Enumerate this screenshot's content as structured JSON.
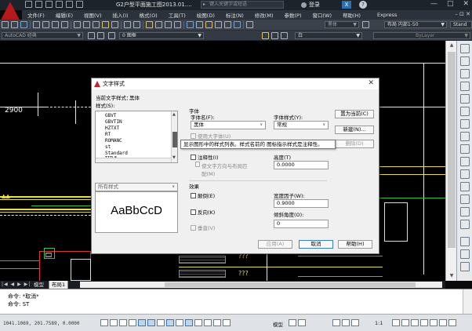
{
  "titlebar": {
    "doc_title": "G2户型平面施工图2013.01....",
    "search_placeholder": "键入关键字或短语",
    "login_label": "登录",
    "help_label": "?",
    "x_label": "X",
    "min": "—",
    "max": "□",
    "close": "✕"
  },
  "menubar": {
    "items": [
      "文件(F)",
      "编辑(E)",
      "视图(V)",
      "插入(I)",
      "格式(O)",
      "工具(T)",
      "绘图(D)",
      "标注(N)",
      "修改(M)",
      "参数(P)",
      "窗口(W)",
      "帮助(H)",
      "Express"
    ],
    "ctrls": "– ⊡ ✕"
  },
  "toolbar1": {
    "font_combo": "黑体",
    "layout_combo": "布局 内部1-50",
    "standard_label": "Stand"
  },
  "toolbar2": {
    "workspace_combo": "AutoCAD 经典",
    "layer_combo": "0 图框",
    "color_combo": "白",
    "linetype_combo": "ByLayer"
  },
  "drawing": {
    "dim_text": "2900",
    "q1": "???",
    "q2": "???"
  },
  "tabs": {
    "nav": "|◀ ◀ ▶ ▶|",
    "model": "模型",
    "layout": "布局1"
  },
  "cmdline": {
    "line1": "命令: *取消*",
    "line2": "命令: ST"
  },
  "statusbar": {
    "coords": "1041.1069, 201.7589, 0.0000",
    "model_label": "模型",
    "scale_label": "1:1"
  },
  "dialog": {
    "title": "文字样式",
    "current_style_label": "当前文字样式：",
    "current_style_value": "黑体",
    "styles_label": "样式(S):",
    "styles": [
      "GBVT",
      "GBVTIN",
      "HZTXT",
      "RT",
      "ROMANC",
      "st",
      "Standard",
      "TITLE…"
    ],
    "filter_value": "所有样式",
    "preview_text": "AaBbCcD",
    "font_group": "字体",
    "font_name_label": "字体名(F):",
    "font_name_value": "黑体",
    "font_style_label": "字体样式(Y):",
    "font_style_value": "常规",
    "big_font_label": "使用大字体(U)",
    "size_group": "大小",
    "annotative_label": "注释性(I)",
    "match_orientation_label": "使文字方向与布局匹配(M)",
    "height_label": "高度(T)",
    "height_value": "0.0000",
    "effects_group": "效果",
    "upside_down_label": "颠倒(E)",
    "backwards_label": "反向(K)",
    "vertical_label": "垂直(V)",
    "width_factor_label": "宽度因子(W):",
    "width_factor_value": "0.9000",
    "oblique_label": "倾斜角度(O):",
    "oblique_value": "0",
    "set_current_btn": "置为当前(C)",
    "new_btn": "新建(N)...",
    "delete_btn": "删除(D)",
    "apply_btn": "应用(A)",
    "cancel_btn": "取消",
    "help_btn": "帮助(H)",
    "close": "✕",
    "tooltip": "显示图形中的样式列表。样式名前的 图标指示样式是注释性。"
  }
}
